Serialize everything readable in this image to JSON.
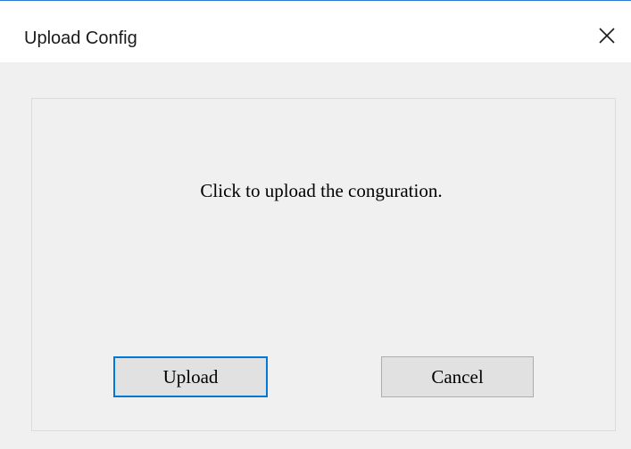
{
  "window": {
    "title": "Upload Config"
  },
  "dialog": {
    "message": "Click to upload the conguration.",
    "buttons": {
      "upload_label": "Upload",
      "cancel_label": "Cancel"
    }
  },
  "icons": {
    "close": "close-icon"
  },
  "colors": {
    "accent": "#0078d7",
    "titlebar_bg": "#ffffff",
    "body_bg": "#f0f0f0",
    "button_bg": "#e1e1e1"
  }
}
